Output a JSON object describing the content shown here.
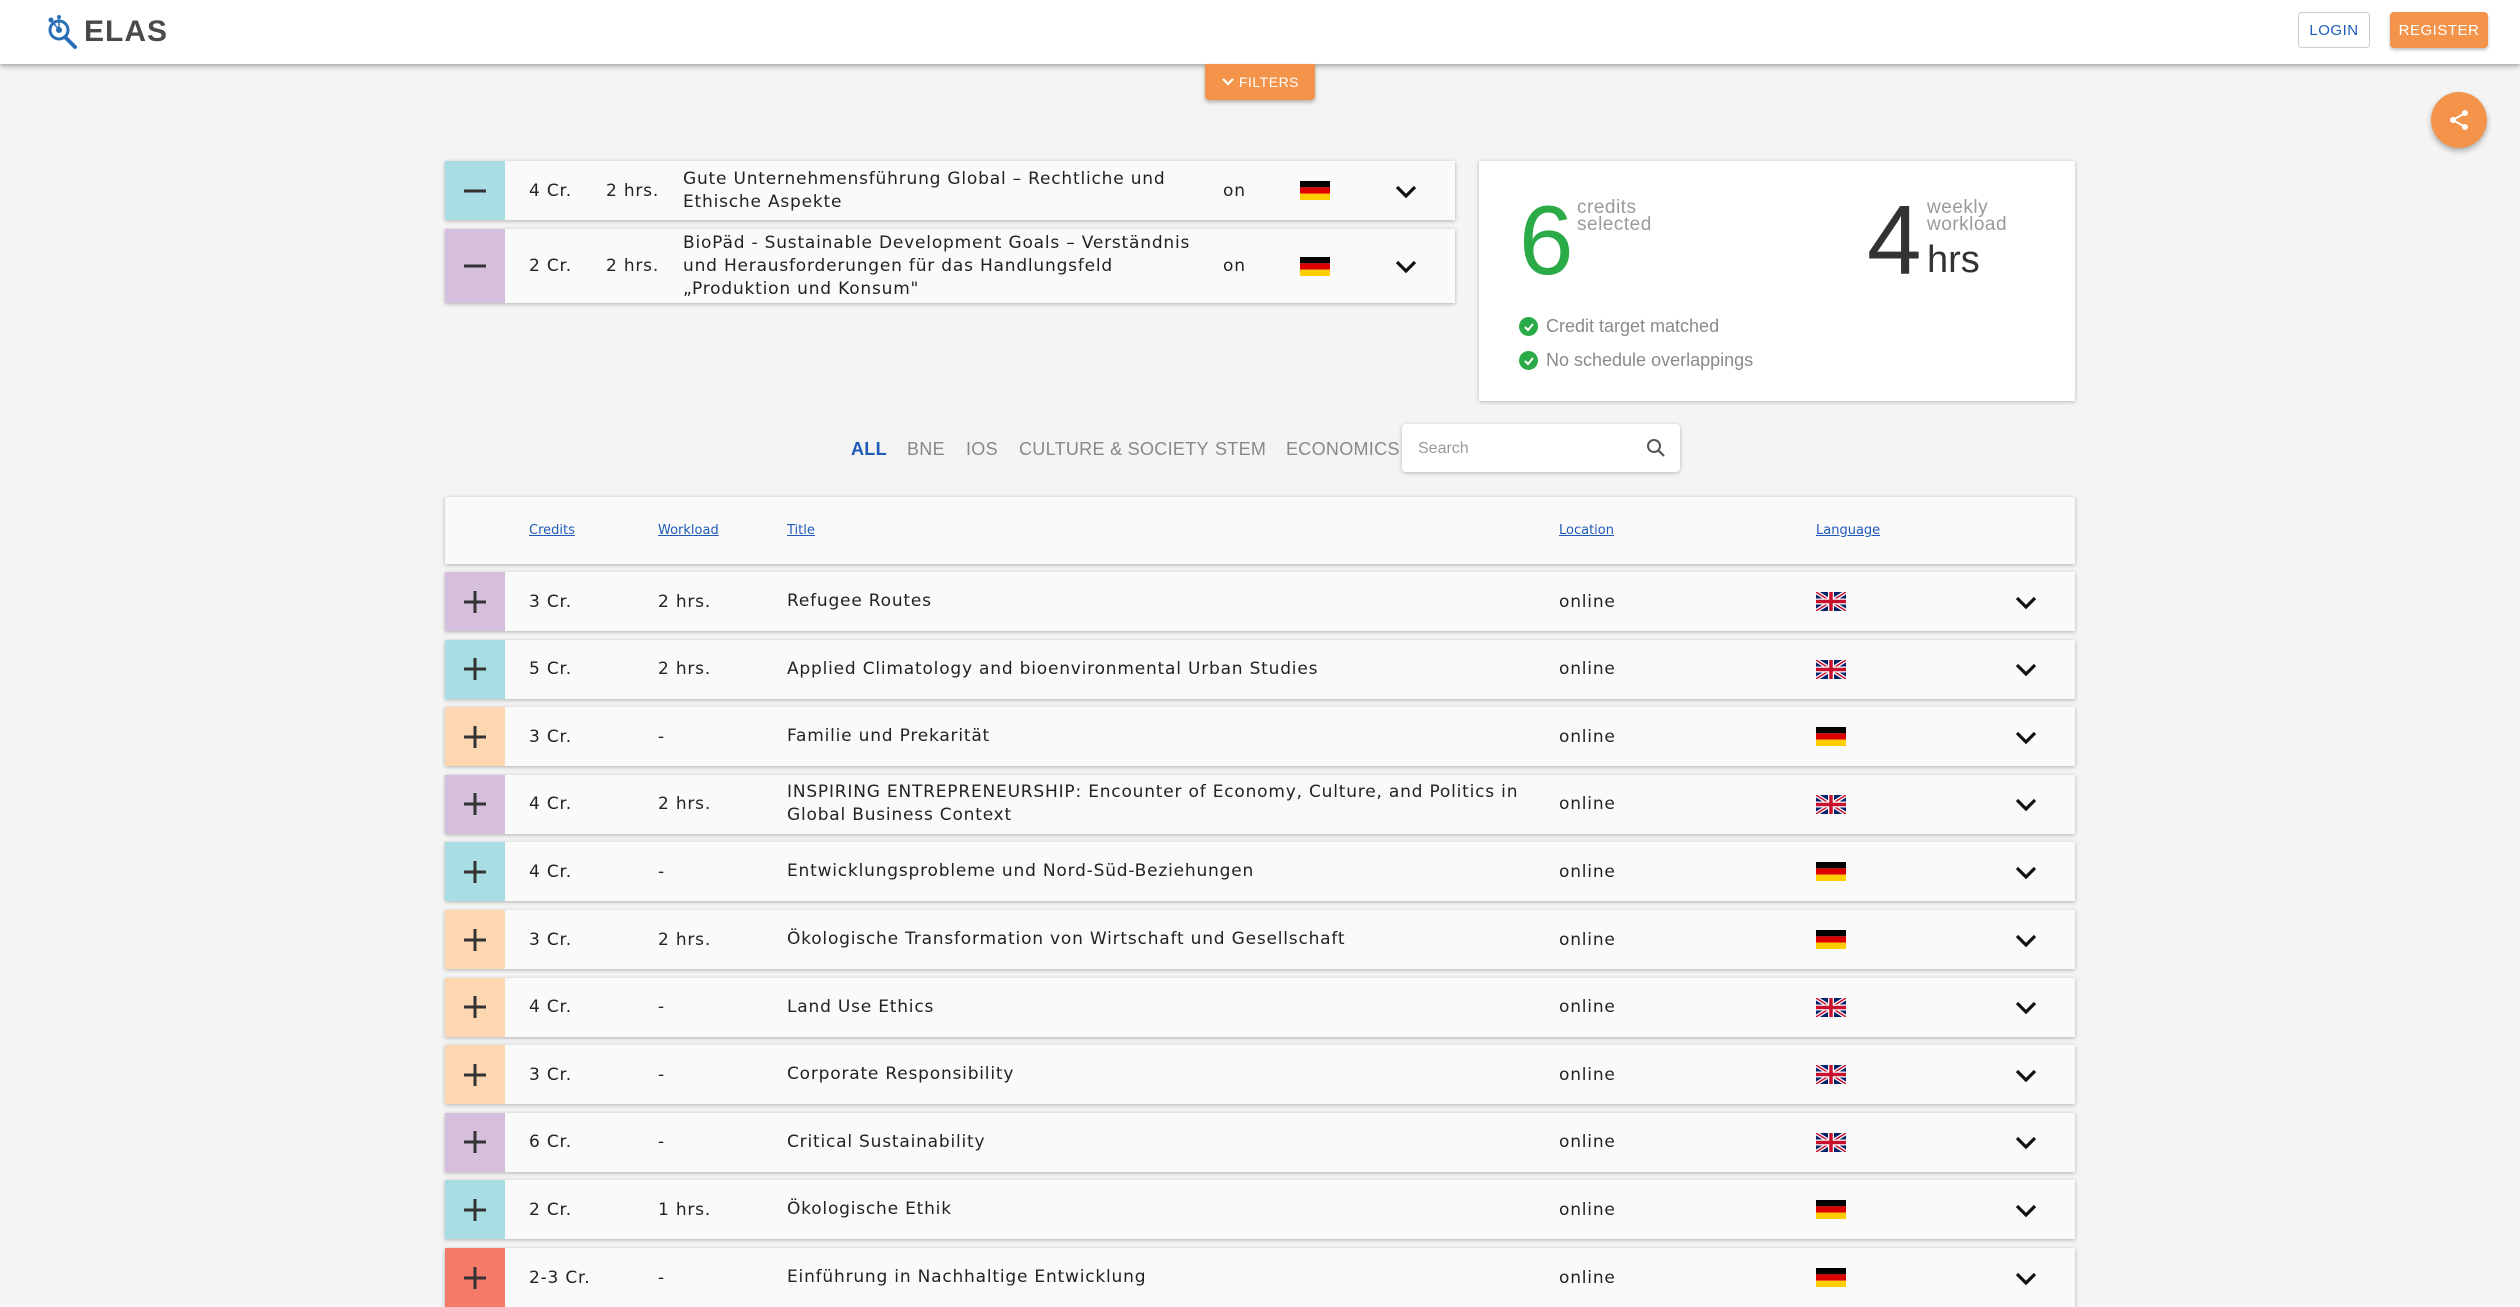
{
  "header": {
    "app_name": "ELAS",
    "login_label": "LOGIN",
    "register_label": "REGISTER",
    "filters_label": "FILTERS"
  },
  "colors": {
    "accent": "#f3944a",
    "link": "#1e5bb8",
    "credits_green": "#2bab48",
    "bne": "#a7dde3",
    "ios": "#d6bfdc",
    "culture": "#fcd7b1",
    "red": "#f67a6a"
  },
  "selected": [
    {
      "credits": "4 Cr.",
      "workload": "2 hrs.",
      "title": "Gute Unternehmensführung Global – Rechtliche und Ethische Aspekte",
      "location": "on",
      "language": "de",
      "color": "#a7dde3",
      "action_icon": "minus-icon"
    },
    {
      "credits": "2 Cr.",
      "workload": "2 hrs.",
      "title": "BioPäd - Sustainable Development Goals – Verständnis und Herausforderungen für das Handlungsfeld „Produktion und Konsum\"",
      "location": "on",
      "language": "de",
      "color": "#d6bfdc",
      "action_icon": "minus-icon"
    }
  ],
  "summary": {
    "credits_value": "6",
    "credits_label": "credits selected",
    "workload_value": "4",
    "workload_unit": "hrs",
    "workload_label": "weekly workload",
    "status_1": "Credit target matched",
    "status_2": "No schedule overlappings"
  },
  "tabs": [
    {
      "label": "ALL",
      "active": true
    },
    {
      "label": "BNE",
      "active": false
    },
    {
      "label": "IOS",
      "active": false
    },
    {
      "label": "CULTURE & SOCIETY",
      "active": false
    },
    {
      "label": "STEM",
      "active": false
    },
    {
      "label": "ECONOMICS",
      "active": false
    }
  ],
  "search": {
    "placeholder": "Search",
    "value": ""
  },
  "table": {
    "columns": {
      "credits": "Credits",
      "workload": "Workload",
      "title": "Title",
      "location": "Location",
      "language": "Language"
    },
    "rows": [
      {
        "credits": "3 Cr.",
        "workload": "2 hrs.",
        "title": "Refugee Routes",
        "location": "online",
        "language": "en",
        "color": "#d6bfdc"
      },
      {
        "credits": "5 Cr.",
        "workload": "2 hrs.",
        "title": "Applied Climatology and bioenvironmental Urban Studies",
        "location": "online",
        "language": "en",
        "color": "#a7dde3"
      },
      {
        "credits": "3 Cr.",
        "workload": "-",
        "title": "Familie und Prekarität",
        "location": "online",
        "language": "de",
        "color": "#fcd7b1"
      },
      {
        "credits": "4 Cr.",
        "workload": "2 hrs.",
        "title": "INSPIRING ENTREPRENEURSHIP: Encounter of Economy, Culture, and Politics in Global Business Context",
        "location": "online",
        "language": "en",
        "color": "#d6bfdc"
      },
      {
        "credits": "4 Cr.",
        "workload": "-",
        "title": "Entwicklungsprobleme und Nord-Süd-Beziehungen",
        "location": "online",
        "language": "de",
        "color": "#a7dde3"
      },
      {
        "credits": "3 Cr.",
        "workload": "2 hrs.",
        "title": "Ökologische Transformation von Wirtschaft und Gesellschaft",
        "location": "online",
        "language": "de",
        "color": "#fcd7b1"
      },
      {
        "credits": "4 Cr.",
        "workload": "-",
        "title": "Land Use Ethics",
        "location": "online",
        "language": "en",
        "color": "#fcd7b1"
      },
      {
        "credits": "3 Cr.",
        "workload": "-",
        "title": "Corporate Responsibility",
        "location": "online",
        "language": "en",
        "color": "#fcd7b1"
      },
      {
        "credits": "6 Cr.",
        "workload": "-",
        "title": "Critical Sustainability",
        "location": "online",
        "language": "en",
        "color": "#d6bfdc"
      },
      {
        "credits": "2 Cr.",
        "workload": "1 hrs.",
        "title": "Ökologische Ethik",
        "location": "online",
        "language": "de",
        "color": "#a7dde3"
      },
      {
        "credits": "2-3 Cr.",
        "workload": "-",
        "title": "Einführung in Nachhaltige Entwicklung",
        "location": "online",
        "language": "de",
        "color": "#f67a6a"
      }
    ]
  }
}
